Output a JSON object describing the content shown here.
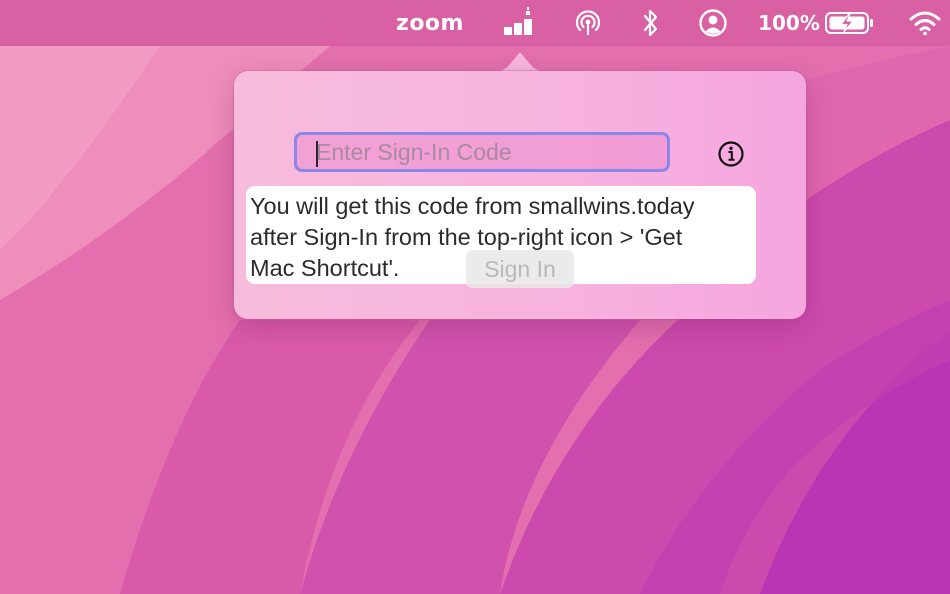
{
  "menubar": {
    "app_name": "zoom",
    "battery_percent": "100%",
    "icons": [
      "signal-bars-icon",
      "airdrop-icon",
      "bluetooth-icon",
      "user-account-icon",
      "battery-charging-icon",
      "wifi-icon"
    ]
  },
  "popover": {
    "code_input": {
      "value": "",
      "placeholder": "Enter Sign-In Code"
    },
    "info_icon": "info-icon",
    "help_text": "You will get this code from smallwins.today\nafter Sign-In from the top-right icon > 'Get\nMac Shortcut'.",
    "signin_label": "Sign In"
  },
  "colors": {
    "menubar": "#d65ca0",
    "popover_background": "#f7b3df",
    "input_focus_ring": "#8b86e8",
    "wallpaper_magenta": "#c53fb2"
  }
}
